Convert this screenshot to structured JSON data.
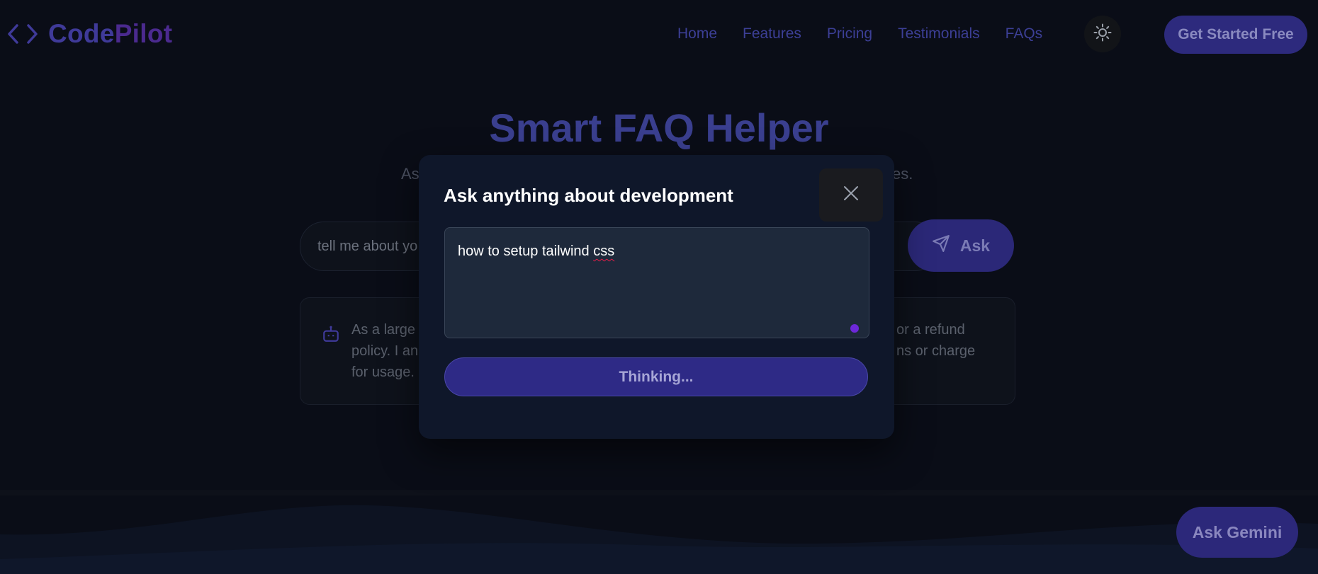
{
  "brand": {
    "name_part1": "Code",
    "name_part2": "Pilot",
    "icon": "code-brackets-icon"
  },
  "nav": {
    "links": [
      "Home",
      "Features",
      "Pricing",
      "Testimonials",
      "FAQs"
    ],
    "theme_icon": "sun-icon",
    "cta_label": "Get Started Free"
  },
  "hero": {
    "title": "Smart FAQ Helper",
    "subtitle_left": "As",
    "subtitle_right": "es."
  },
  "faq": {
    "query_text": "tell me about yo",
    "ask_label": "Ask",
    "ask_icon": "send-icon",
    "answer_icon": "bot-icon",
    "answer_left": [
      "As a large",
      "policy. I an",
      "for usage."
    ],
    "answer_right": [
      "or a refund",
      "ns or charge"
    ]
  },
  "modal": {
    "title": "Ask anything about development",
    "close_icon": "close-icon",
    "input_value_prefix": "how to setup tailwind ",
    "input_value_flagged": "css",
    "submit_label": "Thinking..."
  },
  "floating": {
    "gemini_label": "Ask Gemini"
  },
  "colors": {
    "background": "#0a0d17",
    "accent": "#2e2a86",
    "modal": "#0f172a"
  }
}
